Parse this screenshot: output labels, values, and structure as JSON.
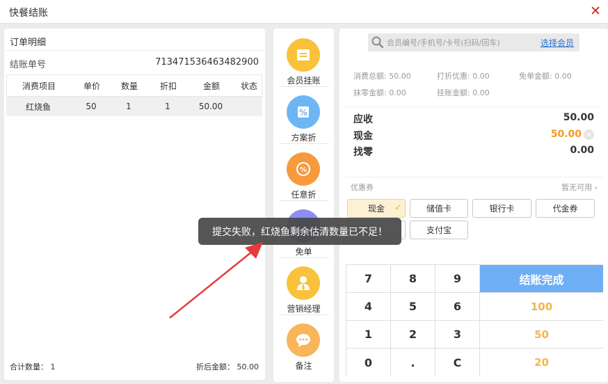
{
  "window": {
    "title": "快餐结账",
    "close_icon": "close-icon",
    "close_glyph": "✕"
  },
  "order": {
    "section_title": "订单明细",
    "number_label": "结账单号",
    "number_value": "713471536463482900",
    "columns": [
      "消费项目",
      "单价",
      "数量",
      "折扣",
      "金额",
      "状态"
    ],
    "rows": [
      {
        "item": "红烧鱼",
        "price": "50",
        "qty": "1",
        "discount": "1",
        "amount": "50.00",
        "status": ""
      }
    ],
    "footer_count": "合计数量：  1",
    "footer_amount": "折后金额：  50.00"
  },
  "actions": [
    {
      "label": "会员挂账",
      "icon": "member-bill-icon",
      "color": "#f9c23a"
    },
    {
      "label": "方案折",
      "icon": "plan-discount-icon",
      "color": "#6eb5f6"
    },
    {
      "label": "任意折",
      "icon": "any-discount-icon",
      "color": "#f79a3e"
    },
    {
      "label": "免单",
      "icon": "free-order-icon",
      "color": "#8c8ff0"
    },
    {
      "label": "营销经理",
      "icon": "marketing-manager-icon",
      "color": "#f9c23a"
    },
    {
      "label": "备注",
      "icon": "remark-icon",
      "color": "#f9b55a"
    }
  ],
  "member": {
    "search_placeholder": "会员编号/手机号/卡号(扫码/回车)",
    "select_link": "选择会员"
  },
  "stats": {
    "total": "消费总额: 50.00",
    "discount": "打折优惠: 0.00",
    "free": "免单金额: 0.00",
    "rounding": "抹零金额: 0.00",
    "credit": "挂账金额: 0.00"
  },
  "amounts": {
    "receivable_label": "应收",
    "receivable_value": "50.00",
    "cash_label": "现金",
    "cash_value": "50.00",
    "change_label": "找零",
    "change_value": "0.00"
  },
  "coupon": {
    "label": "优惠券",
    "none_text": "暂无可用",
    "chevron": "›"
  },
  "payments": [
    "现金",
    "储值卡",
    "银行卡",
    "代金券",
    "",
    "支付宝"
  ],
  "keypad": {
    "digits": [
      "7",
      "8",
      "9",
      "4",
      "5",
      "6",
      "1",
      "2",
      "3",
      "0",
      ".",
      "C"
    ],
    "finish": "结账完成",
    "quick": [
      "100",
      "50",
      "20"
    ]
  },
  "toast": "提交失败，红烧鱼剩余估清数量已不足！",
  "colors": {
    "accent_blue": "#6eaef5",
    "orange": "#f59a23",
    "close_red": "#e02020"
  }
}
